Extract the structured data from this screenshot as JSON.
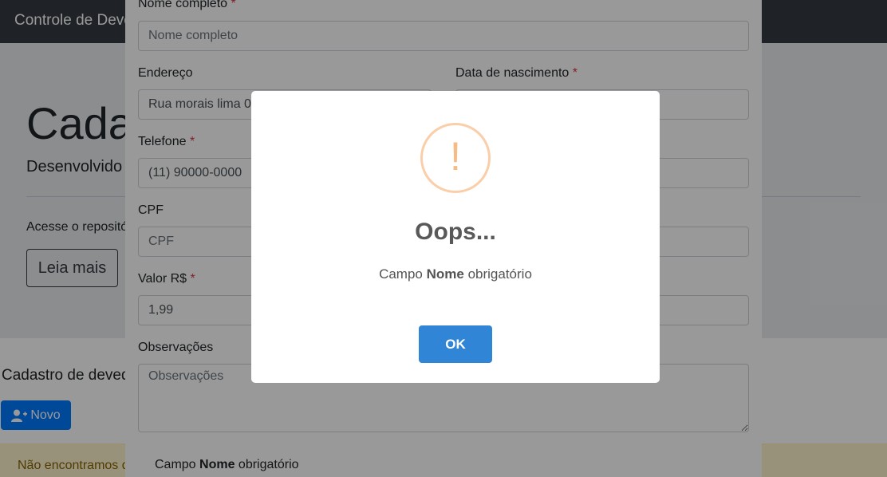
{
  "navbar": {
    "brand": "Controle de Devedores"
  },
  "jumbotron": {
    "title": "Cadastro",
    "subtitle": "Desenvolvido com",
    "text": "Acesse o repositório",
    "button": "Leia mais"
  },
  "section": {
    "title": "Cadastro de devedores",
    "new_button": "Novo",
    "new_icon": "user-plus-icon"
  },
  "alert": {
    "text": "Não encontramos devedores"
  },
  "form": {
    "nome": {
      "label": "Nome completo",
      "required": "*",
      "placeholder": "Nome completo"
    },
    "endereco": {
      "label": "Endereço",
      "value": "Rua morais lima 0"
    },
    "nascimento": {
      "label": "Data de nascimento",
      "required": "*",
      "value": ""
    },
    "telefone": {
      "label": "Telefone",
      "required": "*",
      "value": "(11) 90000-0000"
    },
    "cpf": {
      "label": "CPF",
      "placeholder": "CPF"
    },
    "valor": {
      "label": "Valor R$",
      "required": "*",
      "value": "1,99"
    },
    "observacoes": {
      "label": "Observações",
      "placeholder": "Observações"
    },
    "error_prefix": "Campo ",
    "error_field": "Nome",
    "error_suffix": " obrigatório"
  },
  "popup": {
    "icon": "warning-icon",
    "icon_glyph": "!",
    "title": "Oops...",
    "text_prefix": "Campo ",
    "text_field": "Nome",
    "text_suffix": " obrigatório",
    "ok_button": "OK",
    "colors": {
      "ok": "#3085d6",
      "warning": "#f8bb86"
    }
  }
}
